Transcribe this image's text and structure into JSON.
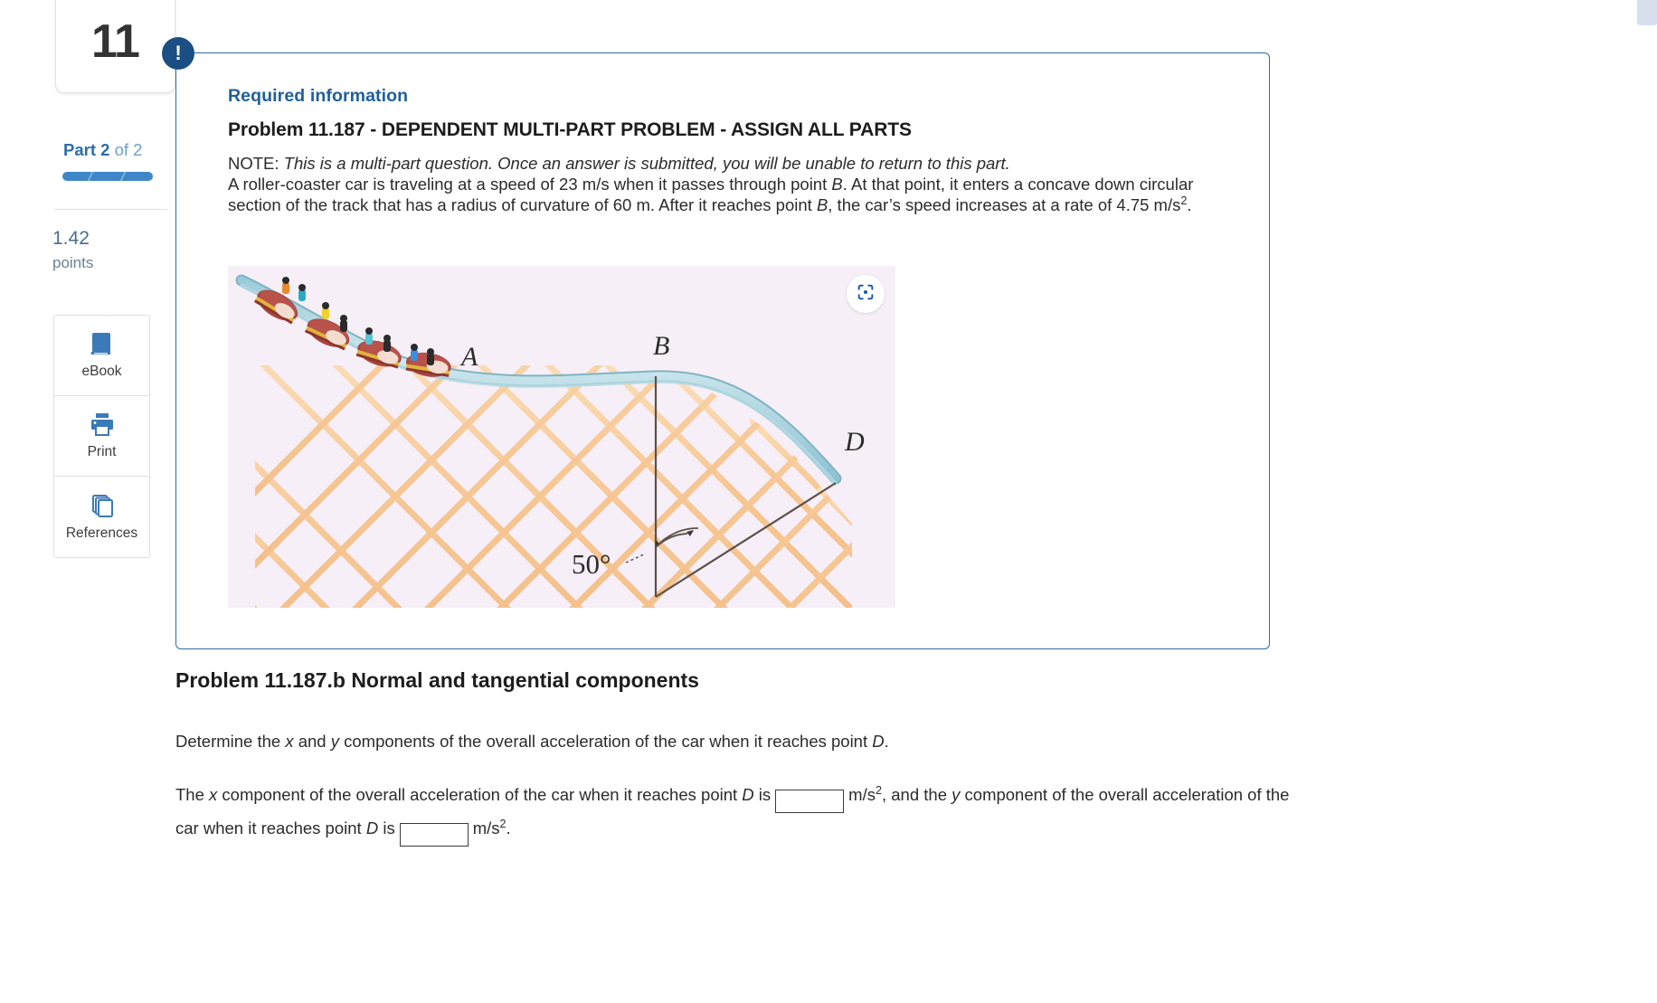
{
  "sidebar": {
    "question_number": "11",
    "part_prefix": "Part",
    "part_current": "2",
    "part_of": "of",
    "part_total": "2",
    "points_value": "1.42",
    "points_label": "points",
    "tools": [
      {
        "label": "eBook",
        "icon": "book-icon"
      },
      {
        "label": "Print",
        "icon": "printer-icon"
      },
      {
        "label": "References",
        "icon": "copy-pages-icon"
      }
    ]
  },
  "info_box": {
    "badge_icon": "exclamation-icon",
    "badge_text": "!",
    "required_information": "Required information",
    "problem_title": "Problem 11.187 - DEPENDENT MULTI-PART PROBLEM - ASSIGN ALL PARTS",
    "note_label": "NOTE:",
    "note_italic": "This is a multi-part question. Once an answer is submitted, you will be unable to return to this part.",
    "body_p1_a": "A roller-coaster car is traveling at a speed of 23 m/s when it passes through point ",
    "body_p1_b": "B",
    "body_p1_c": ". At that point, it enters a concave down circular section of the track that has a radius of curvature of 60 m. After it reaches point ",
    "body_p1_d": "B",
    "body_p1_e": ", the car’s speed increases at a rate of 4.75 m/s",
    "body_p1_sup": "2",
    "body_p1_f": "."
  },
  "figure": {
    "background": "#f7eff7",
    "expand_icon": "scan-expand-icon",
    "labels": {
      "a": "A",
      "b": "B",
      "d": "D",
      "angle": "50°"
    },
    "track_color": "#a9d3dd",
    "truss_color": "#f5ce9e",
    "car_color": "#a8453f"
  },
  "question": {
    "sub_title": "Problem 11.187.b Normal and tangential components",
    "prompt_a": "Determine the ",
    "prompt_x": "x",
    "prompt_b": " and ",
    "prompt_y": "y",
    "prompt_c": " components of the overall acceleration of the car when it reaches point ",
    "prompt_d": "D",
    "prompt_e": ".",
    "ans_a": "The ",
    "ans_x": "x",
    "ans_b": " component of the overall acceleration of the car when it reaches point ",
    "ans_d1": "D",
    "ans_c": " is",
    "unit1": "m/s",
    "unit1_sup": "2",
    "ans_d": ", and the ",
    "ans_y": "y",
    "ans_e": " component of the overall acceleration of the car when it reaches point ",
    "ans_d2": "D",
    "ans_f": " is",
    "unit2": "m/s",
    "unit2_sup": "2",
    "ans_g": ".",
    "x_input_value": "",
    "y_input_value": "",
    "x_input_placeholder": "",
    "y_input_placeholder": ""
  },
  "colors": {
    "accent_blue": "#2f6ba5",
    "title_blue": "#1f5f9e",
    "badge_navy": "#1b4f83",
    "tool_icon_blue": "#3b7ab8"
  }
}
